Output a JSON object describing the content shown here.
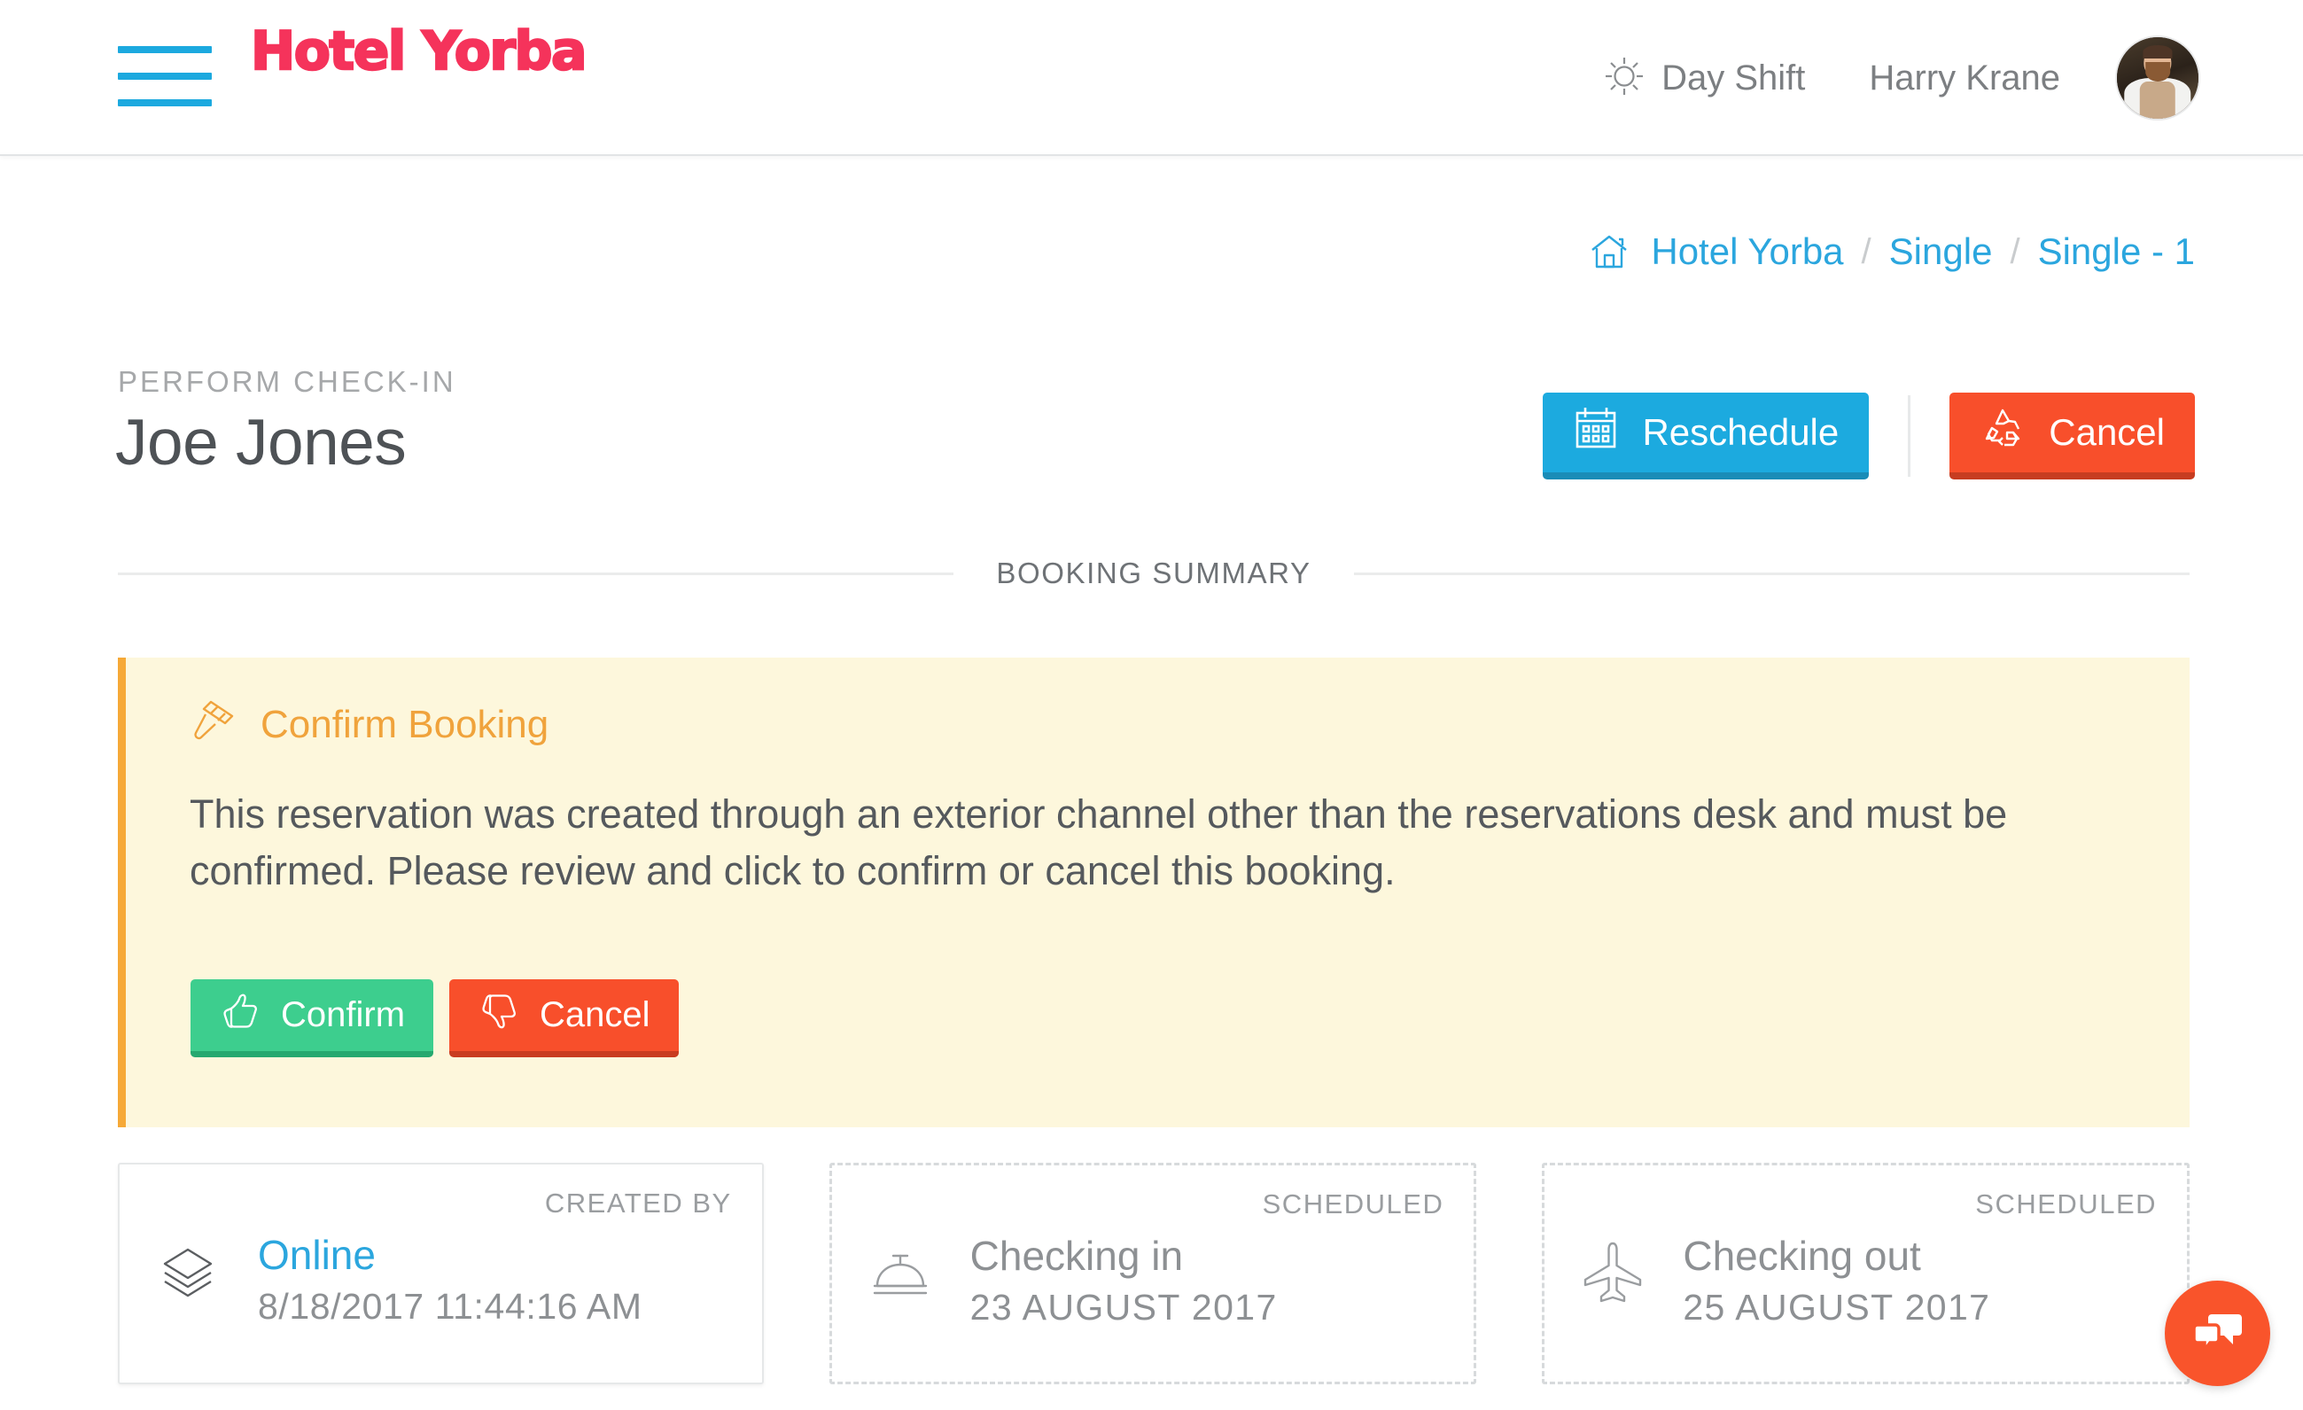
{
  "header": {
    "brand": "Hotel Yorba",
    "menu_icon": "hamburger-icon",
    "shift": {
      "icon": "sun-icon",
      "label": "Day Shift"
    },
    "user": {
      "name": "Harry Krane",
      "avatar": "user-avatar-photo"
    }
  },
  "breadcrumb": {
    "home_icon": "home-icon",
    "items": [
      {
        "label": "Hotel Yorba"
      },
      {
        "label": "Single"
      },
      {
        "label": "Single - 1"
      }
    ],
    "separator": "/"
  },
  "page": {
    "eyebrow": "PERFORM CHECK-IN",
    "title": "Joe Jones"
  },
  "actions": {
    "reschedule": {
      "label": "Reschedule",
      "icon": "calendar-icon"
    },
    "cancel": {
      "label": "Cancel",
      "icon": "recycle-icon"
    }
  },
  "section": {
    "booking_summary_label": "BOOKING SUMMARY"
  },
  "alert": {
    "icon": "gavel-icon",
    "title": "Confirm Booking",
    "body": "This reservation was created through an exterior channel other than the reservations desk and must be confirmed. Please review and click to confirm or cancel this booking.",
    "confirm": {
      "label": "Confirm",
      "icon": "thumbs-up-icon"
    },
    "cancel": {
      "label": "Cancel",
      "icon": "thumbs-down-icon"
    }
  },
  "cards": [
    {
      "tag": "CREATED BY",
      "icon": "layers-icon",
      "heading": "Online",
      "sub": "8/18/2017 11:44:16 AM",
      "style": "solid",
      "heading_is_link": true
    },
    {
      "tag": "SCHEDULED",
      "icon": "service-bell-icon",
      "heading": "Checking in",
      "sub": "23 AUGUST 2017",
      "style": "dashed",
      "heading_is_link": false
    },
    {
      "tag": "SCHEDULED",
      "icon": "airplane-icon",
      "heading": "Checking out",
      "sub": "25 AUGUST 2017",
      "style": "dashed",
      "heading_is_link": false
    }
  ],
  "chat": {
    "icon": "chat-bubbles-icon"
  },
  "colors": {
    "brand_pink": "#F5335B",
    "accent_blue": "#1CAADF",
    "link_blue": "#2BA6DE",
    "danger_red": "#F84F2B",
    "success_green": "#3DCE8E",
    "warning_orange": "#F6A937",
    "alert_bg": "#FDF7DC",
    "chat_orange": "#F9542B"
  }
}
